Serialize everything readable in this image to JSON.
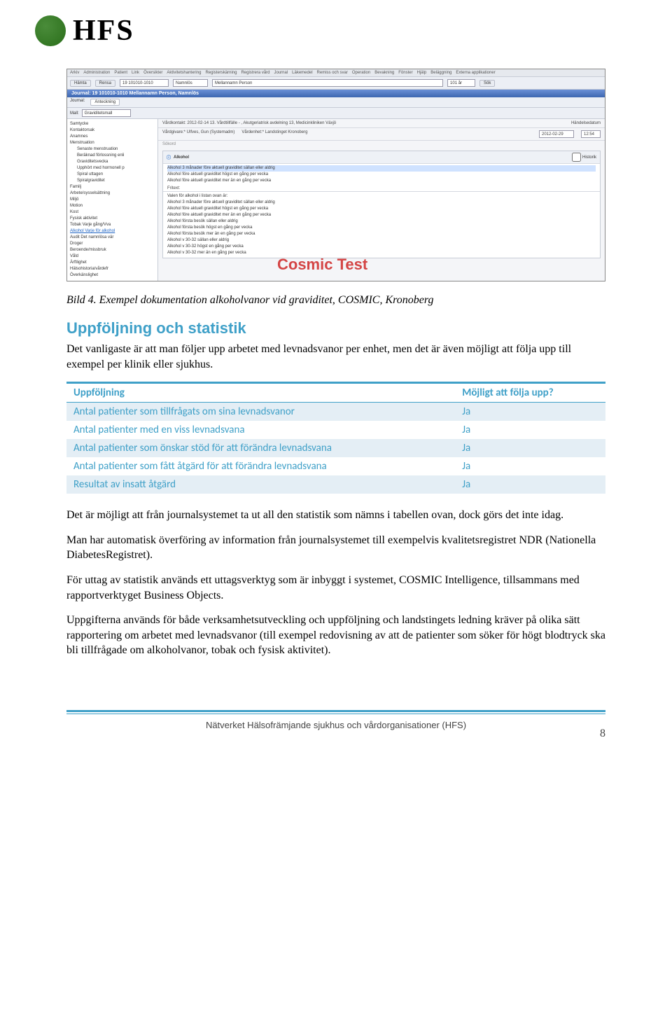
{
  "logo": {
    "text": "HFS"
  },
  "screenshot": {
    "menu": [
      "Arkiv",
      "Administration",
      "Patient",
      "Link",
      "Översikter",
      "Aktivitetshantering",
      "Registerskärning",
      "Registrera vård",
      "Journal",
      "Läkemedel",
      "Remiss och svar",
      "Operation",
      "Bevakning",
      "Fönster",
      "Hjälp",
      "Beläggning",
      "Externa applikationer"
    ],
    "toolbar": {
      "btn_hamta": "Hämta",
      "btn_rensa": "Rensa",
      "field_pid": "19 101010-1010",
      "field_name": "Namnlös",
      "field_mn": "Mellannamn Person",
      "age": "101 år",
      "btn_sok": "Sök"
    },
    "titlebar": "Journal: 19 101010-1010 Mellannamn Person, Namnlös",
    "tabs": {
      "journal": "Journal:",
      "anteckning": "Anteckning"
    },
    "mall_label": "Mall:",
    "mall_value": "Graviditetsmall",
    "info_vardkontakt": "Vårdkontakt: 2012-02-14 13. Vårdtillfälle - , Akutgeriatrisk avdelning 13, Medicinkliniken Växjö",
    "info_vardgivare": "Vårdgivare:* Ulfves, Gun (Systemadm)",
    "info_vardenhet": "Vårdenhet:* Landstinget Kronoberg",
    "handelsedatum": "Händelsedatum",
    "date": "2012-02-29",
    "time": "12:54",
    "tree": [
      "Samtycke",
      "Kontaktorsak",
      "Anamnes",
      "Menstruation",
      "  Senaste menstruation",
      "  Beräknad förlossning enli",
      "  Graviditetsvecka",
      "  Upphört med hormonell p",
      "  Spiral uttagen",
      "  Spiralgraviditet",
      "Familj",
      "Arbete/sysselsättning",
      "Miljö",
      "Motion",
      "Kost",
      "Fysisk aktivitet",
      "Tobak  Varje gång/Vva",
      "Alkohol  Varje för alkohol",
      "Audit  Det namnlösa vär",
      "Droger",
      "Beroende/missbruk",
      "Våld",
      "Ärftlighet",
      "Hälsohistoria/vårdefr",
      "Överkänslighet"
    ],
    "sokord": "Sökord",
    "panel_title": "Alkohol",
    "historik": "Historik",
    "list_top": [
      "Alkohol 3 månader före aktuell graviditet sällan eller aldrig",
      "Alkohol före aktuell graviditet högst en gång per vecka",
      "Alkohol före aktuell graviditet mer än en gång per vecka"
    ],
    "fritext": "Fritext:",
    "fritext_line": "Valen för alkohol i listan ovan är:",
    "list_main": [
      "Alkohol 3 månader före aktuell graviditet sällan eller aldrig",
      "Alkohol före aktuell graviditet högst en gång per vecka",
      "Alkohol före aktuell graviditet mer än en gång per vecka",
      "Alkohol första besök sällan eller aldrig",
      "Alkohol första besök högst en gång per vecka",
      "Alkohol första besök mer än en gång per vecka",
      "Alkohol v 30-32 sällan eller aldrig",
      "Alkohol v 30-32 högst en gång per vecka",
      "Alkohol v 30-32 mer än en gång per vecka"
    ],
    "watermark": "Cosmic Test"
  },
  "caption_prefix": "Bild 4.",
  "caption": "Exempel dokumentation alkoholvanor vid graviditet, COSMIC, Kronoberg",
  "heading_followup": "Uppföljning och statistik",
  "para_intro": "Det vanligaste är att man följer upp arbetet med levnadsvanor per enhet, men det är även möjligt att följa upp till exempel per klinik eller sjukhus.",
  "table": {
    "head1": "Uppföljning",
    "head2": "Möjligt att följa upp?",
    "rows": [
      {
        "c1": "Antal patienter som tillfrågats om sina levnadsvanor",
        "c2": "Ja"
      },
      {
        "c1": "Antal patienter med en viss levnadsvana",
        "c2": "Ja"
      },
      {
        "c1": "Antal patienter som önskar stöd för att förändra levnadsvana",
        "c2": "Ja"
      },
      {
        "c1": "Antal patienter som fått åtgärd för att förändra levnadsvana",
        "c2": "Ja"
      },
      {
        "c1": "Resultat av insatt åtgärd",
        "c2": "Ja"
      }
    ]
  },
  "para_1": "Det är möjligt att från journalsystemet ta ut all den statistik som nämns i tabellen ovan, dock görs det inte idag.",
  "para_2": "Man har automatisk överföring av information från journalsystemet till exempelvis kvalitetsregistret NDR (Nationella DiabetesRegistret).",
  "para_3": "För uttag av statistik används ett uttagsverktyg som är inbyggt i systemet, COSMIC Intelligence, tillsammans med rapportverktyget Business Objects.",
  "para_4": "Uppgifterna används för både verksamhetsutveckling och uppföljning och landstingets ledning kräver på olika sätt rapportering om arbetet med levnadsvanor (till exempel redovisning av att de patienter som söker för högt blodtryck ska bli tillfrågade om alkoholvanor, tobak och fysisk aktivitet).",
  "footer_text": "Nätverket Hälsofrämjande sjukhus och vårdorganisationer (HFS)",
  "page_number": "8"
}
